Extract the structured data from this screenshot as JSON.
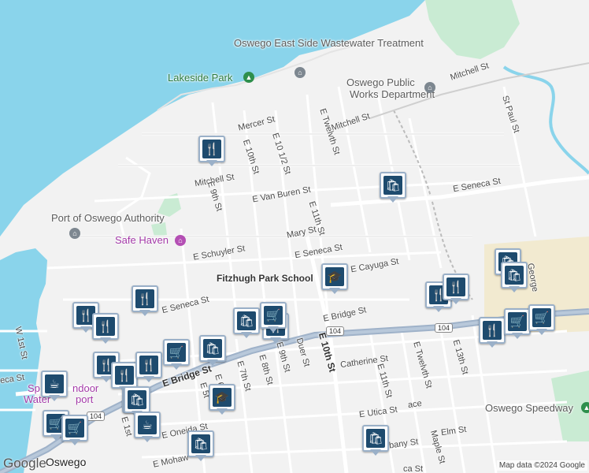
{
  "map": {
    "attribution": "Map data ©2024 Google",
    "logo": "Google",
    "colors": {
      "water": "#8ad4eb",
      "land": "#f2f2f2",
      "park": "#c9ebd3",
      "sand": "#f2ead0",
      "road": "#ffffff",
      "highway": "#9fb2c9",
      "pin": "#1e4b6e"
    }
  },
  "labels": {
    "wastewater": "Oswego East Side Wastewater Treatment",
    "lakeside": "Lakeside Park",
    "public_works_1": "Oswego Public",
    "public_works_2": "Works Department",
    "port": "Port of Oswego Authority",
    "safe_haven": "Safe Haven",
    "fitzhugh": "Fitzhugh Park School",
    "speedway": "Oswego Speedway",
    "sports_1": "Sp",
    "sports_2": "ndoor",
    "waterfront_1": "Water",
    "waterfront_2": "port",
    "city": "Oswego"
  },
  "streets": {
    "mitchell_top": "Mitchell St",
    "mercer": "Mercer St",
    "mitchell_st": "Mitchell St",
    "mitchell_mid": "Mitchell St",
    "e10th": "E 10th St",
    "e10_half": "E 10 1/2 St",
    "e_twelfth_top": "E Twelvth St",
    "e9th_top": "E 9th St",
    "van_buren": "E Van Buren St",
    "e11th_top": "E 11th St",
    "e_seneca_right": "E Seneca St",
    "st_paul": "St Paul St",
    "mary": "Mary St",
    "e_seneca_mid": "E Seneca St",
    "e_schuyler": "E Schuyler St",
    "e_cayuga": "E Cayuga St",
    "george": "George",
    "e_seneca_left": "E Seneca St",
    "e_bridge_mid": "E Bridge St",
    "e_bridge_main": "E Bridge St",
    "e10th_main": "E 10th St",
    "w1st": "W 1st St",
    "eca": "eca St",
    "e6": "E 6",
    "e5": "E 5t",
    "e7th": "E 7th St",
    "e8th": "E 8th St",
    "e9th": "E 9th St",
    "duer": "Duer St",
    "catherine": "Catherine St",
    "e11th_low": "E 11th St",
    "e_twelfth_low": "E Twelvth St",
    "e13th": "E 13th St",
    "e1st": "E 1st",
    "e_oneida": "E Oneida St",
    "e_utica": "E Utica St",
    "ace": "ace",
    "albany": "bany St",
    "maple": "Maple St",
    "elm": "Elm St",
    "e_mohawk": "E Mohaw",
    "ca": "ca St",
    "route_104_a": "104",
    "route_104_b": "104",
    "route_104_c": "104"
  },
  "pins": [
    {
      "name": "restaurant-pin",
      "glyph": "🍴"
    },
    {
      "name": "shopping-bag-pin",
      "glyph": "🛍"
    },
    {
      "name": "school-pin",
      "glyph": "🎓"
    },
    {
      "name": "restaurant-pin",
      "glyph": "🍴"
    },
    {
      "name": "restaurant-pin",
      "glyph": "🍴"
    },
    {
      "name": "restaurant-pin",
      "glyph": "🍴"
    },
    {
      "name": "restaurant-pin",
      "glyph": "🍴"
    },
    {
      "name": "shopping-bag-pin",
      "glyph": "🛍"
    },
    {
      "name": "restaurant-pin",
      "glyph": "🍴"
    },
    {
      "name": "shopping-cart-pin",
      "glyph": "🛒"
    },
    {
      "name": "shopping-bag-pin",
      "glyph": "🛍"
    },
    {
      "name": "restaurant-pin",
      "glyph": "🍴"
    },
    {
      "name": "restaurant-pin",
      "glyph": "🍴"
    },
    {
      "name": "restaurant-pin",
      "glyph": "🍴"
    },
    {
      "name": "shopping-cart-pin",
      "glyph": "🛒"
    },
    {
      "name": "shopping-bag-pin",
      "glyph": "🛍"
    },
    {
      "name": "restaurant-pin",
      "glyph": "🍴"
    },
    {
      "name": "shopping-cart-pin",
      "glyph": "🛒"
    },
    {
      "name": "shopping-cart-pin",
      "glyph": "🛒"
    },
    {
      "name": "shopping-bag-pin",
      "glyph": "🛍"
    },
    {
      "name": "restaurant-pin",
      "glyph": "🍴"
    },
    {
      "name": "restaurant-pin",
      "glyph": "🍴"
    },
    {
      "name": "cafe-pin",
      "glyph": "☕"
    },
    {
      "name": "shopping-bag-pin",
      "glyph": "🛍"
    },
    {
      "name": "school-pin",
      "glyph": "🎓"
    },
    {
      "name": "cafe-pin",
      "glyph": "☕"
    },
    {
      "name": "shopping-cart-pin",
      "glyph": "🛒"
    },
    {
      "name": "shopping-cart-pin",
      "glyph": "🛒"
    },
    {
      "name": "shopping-bag-pin",
      "glyph": "🛍"
    },
    {
      "name": "shopping-bag-pin",
      "glyph": "🛍"
    }
  ]
}
